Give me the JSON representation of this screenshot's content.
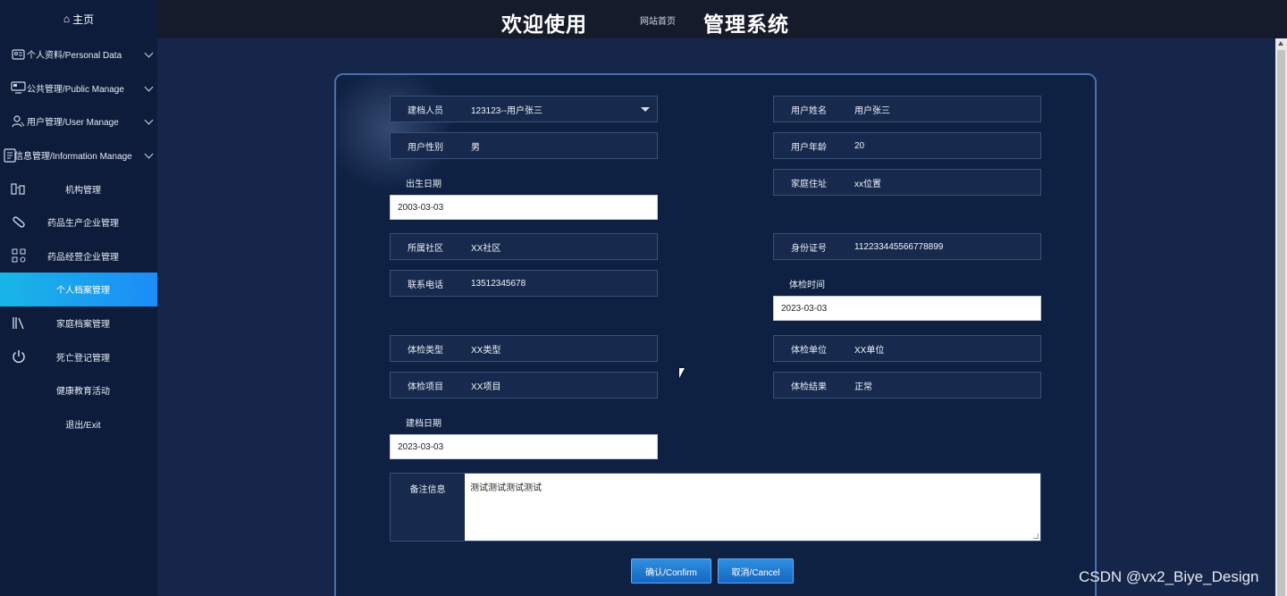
{
  "topbar": {
    "welcome": "欢迎使用",
    "site_home": "网站首页",
    "system": "管理系统"
  },
  "sidebar": {
    "home": "主页",
    "items": [
      {
        "label": "个人资料/Personal Data",
        "icon": "id-card-icon",
        "group": true
      },
      {
        "label": "公共管理/Public Manage",
        "icon": "monitor-icon",
        "group": true
      },
      {
        "label": "用户管理/User Manage",
        "icon": "user-icon",
        "group": true
      },
      {
        "label": "信息管理/Information Manage",
        "icon": "document-icon",
        "group": true
      },
      {
        "label": "机构管理",
        "icon": "building-icon",
        "group": false
      },
      {
        "label": "药品生产企业管理",
        "icon": "pill-icon",
        "group": false
      },
      {
        "label": "药品经营企业管理",
        "icon": "grid-icon",
        "group": false
      },
      {
        "label": "个人档案管理",
        "icon": "",
        "group": false,
        "active": true
      },
      {
        "label": "家庭档案管理",
        "icon": "books-icon",
        "group": false
      },
      {
        "label": "死亡登记管理",
        "icon": "power-icon",
        "group": false
      },
      {
        "label": "健康教育活动",
        "icon": "",
        "group": false
      },
      {
        "label": "退出/Exit",
        "icon": "",
        "group": false
      }
    ]
  },
  "form": {
    "filing_person": {
      "label": "建档人员",
      "value": "123123--用户张三"
    },
    "user_name": {
      "label": "用户姓名",
      "value": "用户张三"
    },
    "gender": {
      "label": "用户性别",
      "value": "男"
    },
    "age": {
      "label": "用户年龄",
      "value": "20"
    },
    "birth_date": {
      "label": "出生日期",
      "value": "2003-03-03"
    },
    "address": {
      "label": "家庭住址",
      "value": "xx位置"
    },
    "community": {
      "label": "所属社区",
      "value": "XX社区"
    },
    "id_number": {
      "label": "身份证号",
      "value": "112233445566778899"
    },
    "phone": {
      "label": "联系电话",
      "value": "13512345678"
    },
    "exam_time": {
      "label": "体检时间",
      "value": "2023-03-03"
    },
    "exam_type": {
      "label": "体检类型",
      "value": "XX类型"
    },
    "exam_unit": {
      "label": "体检单位",
      "value": "XX单位"
    },
    "exam_item": {
      "label": "体检项目",
      "value": "XX项目"
    },
    "exam_result": {
      "label": "体检结果",
      "value": "正常"
    },
    "filing_date": {
      "label": "建档日期",
      "value": "2023-03-03"
    },
    "notes": {
      "label": "备注信息",
      "value": "测试测试测试测试"
    }
  },
  "buttons": {
    "confirm": "确认/Confirm",
    "cancel": "取消/Cancel"
  },
  "watermark": "CSDN @vx2_Biye_Design",
  "colors": {
    "sidebar_bg": "#0d1c3a",
    "main_bg": "#16264a",
    "active_item": "#1d8cf8",
    "topbar_bg": "#161b2b"
  }
}
